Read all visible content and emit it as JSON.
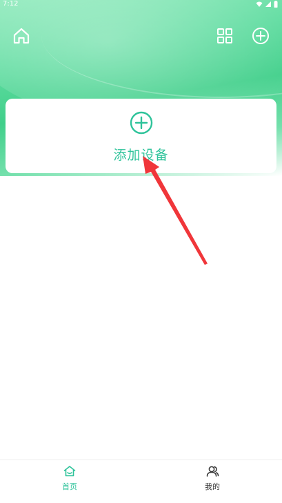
{
  "status_bar": {
    "time": "7:12"
  },
  "header": {
    "home_icon": "home-icon",
    "scan_icon": "grid-icon",
    "add_icon": "plus-circle-icon"
  },
  "main": {
    "add_device": {
      "label": "添加设备",
      "icon": "plus-circle-icon"
    }
  },
  "bottom_nav": {
    "items": [
      {
        "label": "首页",
        "icon": "home-outline-icon",
        "active": true
      },
      {
        "label": "我的",
        "icon": "users-icon",
        "active": false
      }
    ]
  },
  "colors": {
    "accent": "#2ec39a",
    "header_green": "#40cf8a",
    "arrow_red": "#f0363a"
  }
}
